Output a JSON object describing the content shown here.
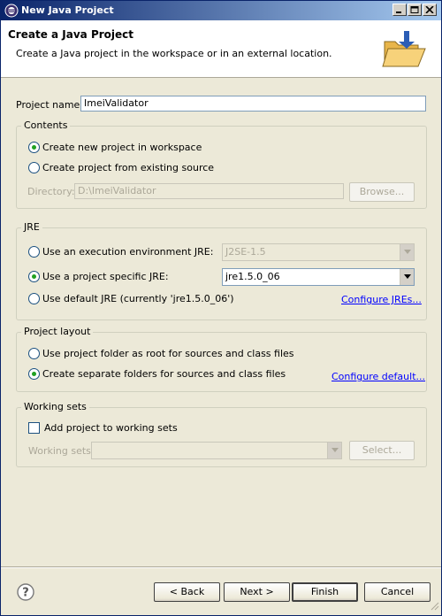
{
  "window": {
    "title": "New Java Project",
    "app_icon": "eclipse-icon",
    "controls": [
      "minimize-icon",
      "maximize-icon",
      "close-icon"
    ]
  },
  "header": {
    "title": "Create a Java Project",
    "description": "Create a Java project in the workspace or in an external location.",
    "icon": "java-folder-icon"
  },
  "project_name": {
    "label": "Project name:",
    "value": "ImeiValidator"
  },
  "contents": {
    "title": "Contents",
    "create_new": {
      "label": "Create new project in workspace",
      "selected": true
    },
    "from_existing": {
      "label": "Create project from existing source",
      "selected": false
    },
    "directory": {
      "label": "Directory:",
      "value": "D:\\ImeiValidator",
      "enabled": false
    },
    "browse_label": "Browse..."
  },
  "jre": {
    "title": "JRE",
    "execution_env": {
      "label": "Use an execution environment JRE:",
      "value": "J2SE-1.5",
      "selected": false
    },
    "project_specific": {
      "label": "Use a project specific JRE:",
      "value": "jre1.5.0_06",
      "selected": true
    },
    "default_jre": {
      "label": "Use default JRE (currently 'jre1.5.0_06')",
      "selected": false
    },
    "configure_link": "Configure JREs..."
  },
  "layout": {
    "title": "Project layout",
    "root_folder": {
      "label": "Use project folder as root for sources and class files",
      "selected": false
    },
    "separate_folders": {
      "label": "Create separate folders for sources and class files",
      "selected": true
    },
    "configure_link": "Configure default..."
  },
  "working_sets": {
    "title": "Working sets",
    "add_label": "Add project to working sets",
    "add_checked": false,
    "sets_label": "Working sets:",
    "sets_value": "",
    "select_label": "Select..."
  },
  "footer": {
    "help_icon": "help-icon",
    "back_label": "< Back",
    "next_label": "Next >",
    "finish_label": "Finish",
    "cancel_label": "Cancel"
  },
  "colors": {
    "title_bar_start": "#0a246a",
    "title_bar_end": "#a6caf0",
    "dialog_bg": "#ece9d8",
    "link": "#0000ff",
    "radio_dot": "#21a121"
  }
}
